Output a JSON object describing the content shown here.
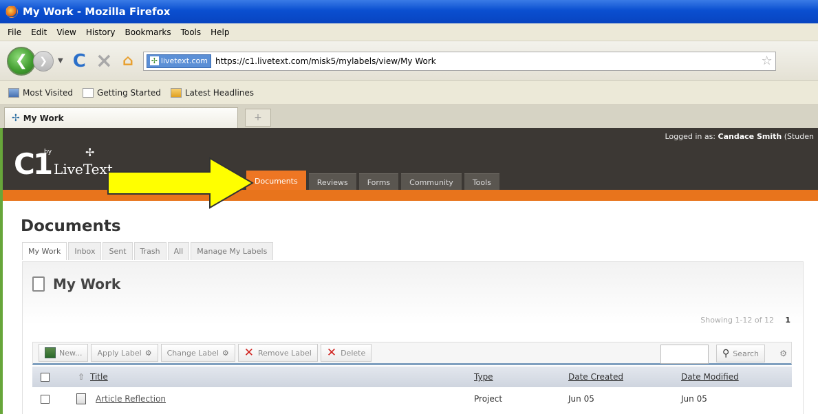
{
  "window": {
    "title": "My Work - Mozilla Firefox"
  },
  "menu": [
    "File",
    "Edit",
    "View",
    "History",
    "Bookmarks",
    "Tools",
    "Help"
  ],
  "navigation": {
    "site_badge": "livetext.com",
    "url": "https://c1.livetext.com/misk5/mylabels/view/My Work"
  },
  "bookmarks": [
    "Most Visited",
    "Getting Started",
    "Latest Headlines"
  ],
  "tabs": [
    {
      "label": "My Work"
    }
  ],
  "header": {
    "login_prefix": "Logged in as:",
    "user": "Candace Smith",
    "role": "(Studen",
    "logo_by": "by",
    "logo_c1": "C1",
    "logo_text": "LiveText",
    "nav": [
      {
        "label": "Documents",
        "active": true
      },
      {
        "label": "Reviews",
        "active": false
      },
      {
        "label": "Forms",
        "active": false
      },
      {
        "label": "Community",
        "active": false
      },
      {
        "label": "Tools",
        "active": false
      }
    ]
  },
  "page": {
    "title": "Documents",
    "subtabs": [
      "My Work",
      "Inbox",
      "Sent",
      "Trash",
      "All",
      "Manage My Labels"
    ],
    "panel_title": "My Work",
    "showing": "Showing 1-12 of 12",
    "page_number": "1"
  },
  "toolbar": {
    "new": "New...",
    "apply_label": "Apply Label",
    "change_label": "Change Label",
    "remove_label": "Remove Label",
    "delete": "Delete",
    "search": "Search",
    "search_value": ""
  },
  "table": {
    "columns": [
      "Title",
      "Type",
      "Date Created",
      "Date Modified"
    ],
    "rows": [
      {
        "title": "Article Reflection",
        "type": "Project",
        "created": "Jun 05",
        "modified": "Jun 05"
      }
    ]
  },
  "colors": {
    "accent": "#ee7623",
    "header_bg": "#3c3834",
    "arrow": "#ffff00"
  }
}
